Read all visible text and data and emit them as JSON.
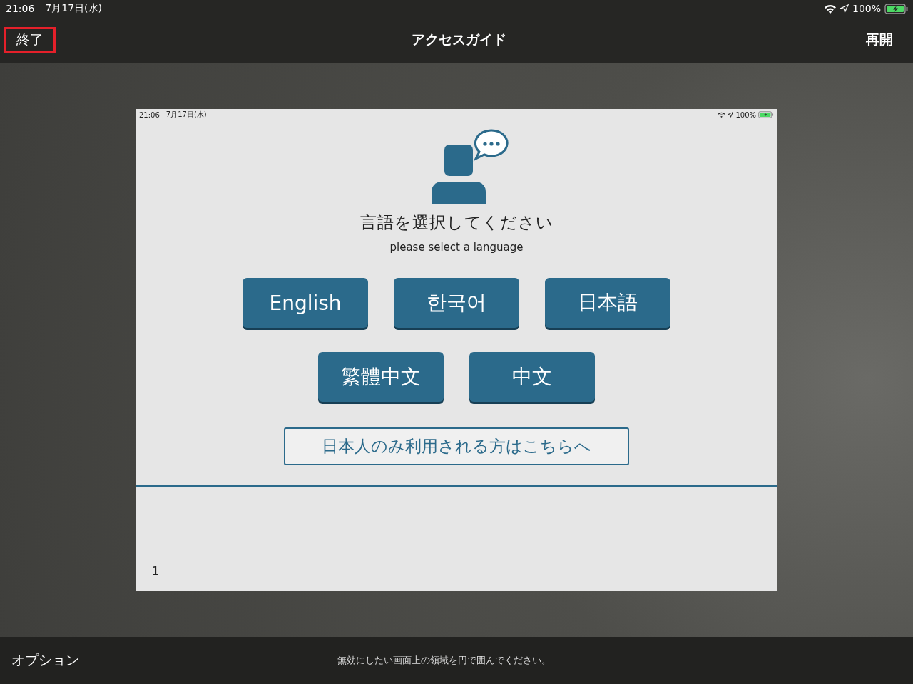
{
  "status_bar": {
    "time": "21:06",
    "date": "7月17日(水)",
    "battery": "100%"
  },
  "nav_bar": {
    "end_button": {
      "label": "終了",
      "highlighted": true
    },
    "title": "アクセスガイド",
    "resume_button": {
      "label": "再開"
    }
  },
  "preview": {
    "status_bar": {
      "time": "21:06",
      "date": "7月17日(水)",
      "battery": "100%"
    },
    "heading": "言語を選択してください",
    "subheading": "please select a language",
    "language_rows": [
      [
        "English",
        "한국어",
        "日本語"
      ],
      [
        "繁體中文",
        "中文"
      ]
    ],
    "japanese_only_link": "日本人のみ利用される方はこちらへ",
    "page_number": "1"
  },
  "bottom_bar": {
    "options": "オプション",
    "hint": "無効にしたい画面上の領域を円で囲んでください。"
  }
}
